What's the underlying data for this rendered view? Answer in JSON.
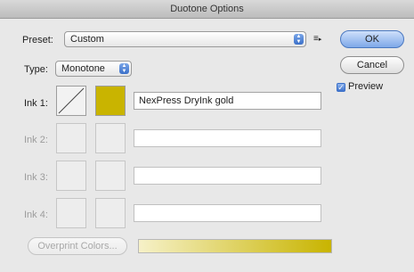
{
  "dialog": {
    "title": "Duotone Options",
    "preset_label": "Preset:",
    "preset_value": "Custom",
    "preset_menu_icon": "flyout-menu-icon",
    "type_label": "Type:",
    "type_value": "Monotone",
    "buttons": {
      "ok": "OK",
      "cancel": "Cancel"
    },
    "preview": {
      "label": "Preview",
      "checked": true
    },
    "inks": [
      {
        "label": "Ink 1:",
        "name": "NexPress DryInk gold",
        "color": "#c9b400",
        "enabled": true
      },
      {
        "label": "Ink 2:",
        "name": "",
        "enabled": false
      },
      {
        "label": "Ink 3:",
        "name": "",
        "enabled": false
      },
      {
        "label": "Ink 4:",
        "name": "",
        "enabled": false
      }
    ],
    "overprint_label": "Overprint Colors...",
    "ramp_colors": {
      "start": "#f6f1c8",
      "end": "#c8b400"
    }
  }
}
